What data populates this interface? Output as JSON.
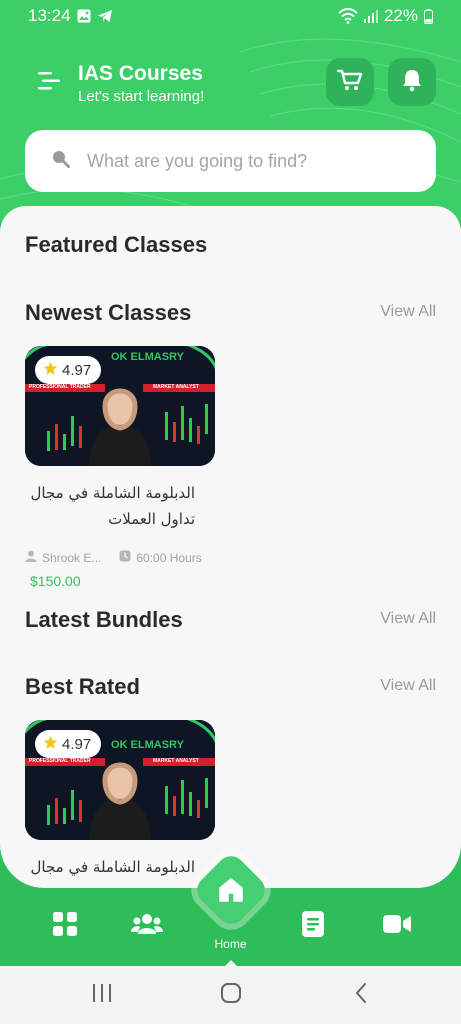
{
  "status_bar": {
    "time": "13:24",
    "battery": "22%",
    "icons": [
      "gallery-icon",
      "telegram-icon",
      "wifi-icon",
      "signal-icon",
      "battery-icon"
    ]
  },
  "header": {
    "title": "IAS Courses",
    "subtitle": "Let's start learning!",
    "icons": [
      "menu-icon",
      "cart-icon",
      "bell-icon"
    ]
  },
  "search": {
    "placeholder": "What are you going to find?"
  },
  "sections": {
    "featured": {
      "title": "Featured Classes"
    },
    "newest": {
      "title": "Newest Classes",
      "view_all": "View All"
    },
    "bundles": {
      "title": "Latest Bundles",
      "view_all": "View All"
    },
    "best_rated": {
      "title": "Best Rated",
      "view_all": "View All"
    }
  },
  "newest_course": {
    "rating": "4.97",
    "title": "الدبلومة الشاملة في مجال تداول العملات",
    "instructor": "Shrook E...",
    "hours": "60:00 Hours",
    "price": "$150.00",
    "thumb_banner": "OK ELMASRY",
    "thumb_left_tag": "PROFESSIONAL TRADER",
    "thumb_right_tag": "MARKET ANALYST"
  },
  "best_course": {
    "rating": "4.97",
    "title": "الدبلومة الشاملة في مجال",
    "thumb_banner": "OK ELMASRY",
    "thumb_left_tag": "PROFESSIONAL TRADER",
    "thumb_right_tag": "MARKET ANALYST"
  },
  "bottom_nav": {
    "active_label": "Home",
    "items": [
      "categories-icon",
      "users-icon",
      "home-icon",
      "document-icon",
      "video-icon"
    ]
  },
  "colors": {
    "brand": "#3ccf68",
    "brand_dark": "#2ebd59",
    "price": "#34c15e",
    "star": "#f5c518"
  }
}
